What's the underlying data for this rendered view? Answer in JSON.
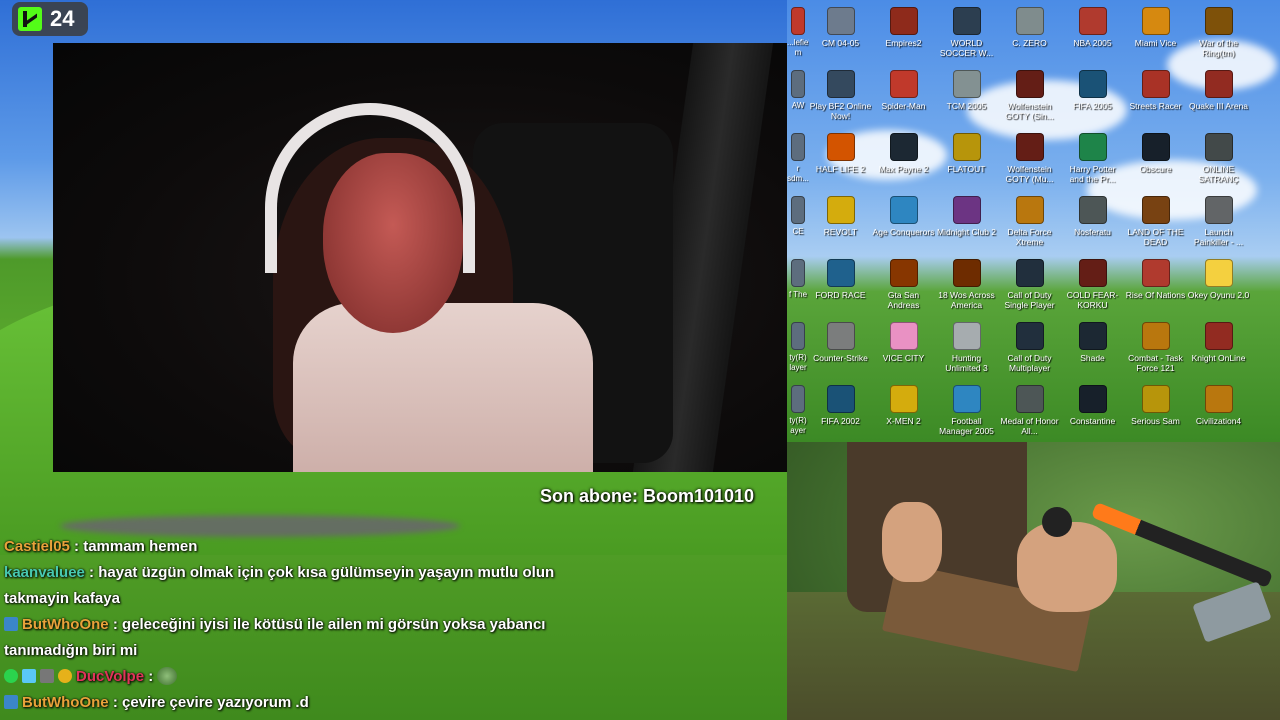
{
  "kick": {
    "viewer_count": "24"
  },
  "overlay": {
    "last_subscriber": "Son abone: Boom101010"
  },
  "chat": [
    {
      "user": "Castiel05",
      "user_color": "#e8a23a",
      "text": " : tammam hemen",
      "badges": []
    },
    {
      "user": "kaanvaluee",
      "user_color": "#48c9b0",
      "text": " : hayat üzgün olmak için çok kısa gülümseyin yaşayın mutlu olun takmayin kafaya",
      "badges": []
    },
    {
      "user": "ButWhoOne",
      "user_color": "#e8a23a",
      "text": " : geleceğini iyisi ile kötüsü ile ailen mi görsün yoksa yabancı tanımadığın biri mi",
      "badges": [
        "blue"
      ]
    },
    {
      "user": "DucVolpe",
      "user_color": "#e0345a",
      "text": " : ",
      "badges": [
        "green",
        "cube",
        "gray",
        "gold"
      ],
      "emote": "frog-emote"
    },
    {
      "user": "ButWhoOne",
      "user_color": "#e8a23a",
      "text": " : çevire çevire yazıyorum .d",
      "badges": [
        "blue"
      ]
    }
  ],
  "desktop": {
    "rows": [
      [
        {
          "label": "...lefield m",
          "color": "#c0392b"
        },
        {
          "label": "CM 04-05",
          "color": "#6d7b8d"
        },
        {
          "label": "Empires2",
          "color": "#8e2a1b"
        },
        {
          "label": "WORLD SOCCER W...",
          "color": "#2c3e50"
        },
        {
          "label": "C. ZERO",
          "color": "#7f8c8d"
        },
        {
          "label": "NBA 2005",
          "color": "#b03a2e"
        },
        {
          "label": "Miami Vice",
          "color": "#d68910"
        },
        {
          "label": "War of the Ring(tm)",
          "color": "#7e5109"
        }
      ],
      [
        {
          "label": "AW",
          "color": "#5d6d7e"
        },
        {
          "label": "Play BF2 Online Now!",
          "color": "#34495e"
        },
        {
          "label": "Spider-Man",
          "color": "#c0392b"
        },
        {
          "label": "TCM 2005",
          "color": "#839192"
        },
        {
          "label": "Wolfenstein GOTY (Sin...",
          "color": "#641e16"
        },
        {
          "label": "FIFA 2005",
          "color": "#1a5276"
        },
        {
          "label": "Streets Racer",
          "color": "#a93226"
        },
        {
          "label": "Quake III Arena",
          "color": "#922b21"
        }
      ],
      [
        {
          "label": "r sdm...",
          "color": "#5d6d7e"
        },
        {
          "label": "HALF LIFE 2",
          "color": "#d35400"
        },
        {
          "label": "Max Payne 2",
          "color": "#1c2833"
        },
        {
          "label": "FLATOUT",
          "color": "#b7950b"
        },
        {
          "label": "Wolfenstein GOTY (Mu...",
          "color": "#641e16"
        },
        {
          "label": "Harry Potter and the Pr...",
          "color": "#1e8449"
        },
        {
          "label": "Obscure",
          "color": "#17202a"
        },
        {
          "label": "ONLINE SATRANÇ",
          "color": "#424949"
        }
      ],
      [
        {
          "label": "CE",
          "color": "#5d6d7e"
        },
        {
          "label": "REVOLT",
          "color": "#d4ac0d"
        },
        {
          "label": "Age Conquerors",
          "color": "#2e86c1"
        },
        {
          "label": "Midnight Club 2",
          "color": "#6c3483"
        },
        {
          "label": "Delta Force Xtreme",
          "color": "#b9770e"
        },
        {
          "label": "Nosferatu",
          "color": "#4d5656"
        },
        {
          "label": "LAND OF THE DEAD",
          "color": "#784212"
        },
        {
          "label": "Launch Painkiller - ...",
          "color": "#626567"
        }
      ],
      [
        {
          "label": "f The",
          "color": "#5d6d7e"
        },
        {
          "label": "FORD RACE",
          "color": "#1f618d"
        },
        {
          "label": "Gta San Andreas",
          "color": "#873600"
        },
        {
          "label": "18 Wos Across America",
          "color": "#6e2c00"
        },
        {
          "label": "Call of Duty Single Player",
          "color": "#212f3d"
        },
        {
          "label": "COLD FEAR-KORKU",
          "color": "#641e16"
        },
        {
          "label": "Rise Of Nations",
          "color": "#b03a2e"
        },
        {
          "label": "Okey Oyunu 2.0",
          "color": "#f4d03f"
        }
      ],
      [
        {
          "label": "ty(R) layer",
          "color": "#5d6d7e"
        },
        {
          "label": "Counter-Strike",
          "color": "#7b7d7d"
        },
        {
          "label": "VICE CITY",
          "color": "#e991c3"
        },
        {
          "label": "Hunting Unlimited 3",
          "color": "#a6acaf"
        },
        {
          "label": "Call of Duty Multiplayer",
          "color": "#212f3d"
        },
        {
          "label": "Shade",
          "color": "#1c2833"
        },
        {
          "label": "Combat - Task Force 121",
          "color": "#b9770e"
        },
        {
          "label": "Knight OnLine",
          "color": "#922b21"
        }
      ],
      [
        {
          "label": "ty(R) ayer",
          "color": "#5d6d7e"
        },
        {
          "label": "FIFA 2002",
          "color": "#1a5276"
        },
        {
          "label": "X-MEN 2",
          "color": "#d4ac0d"
        },
        {
          "label": "Football Manager 2005",
          "color": "#2e86c1"
        },
        {
          "label": "Medal of Honor All...",
          "color": "#4d5656"
        },
        {
          "label": "Constantine",
          "color": "#17202a"
        },
        {
          "label": "Serious Sam",
          "color": "#b7950b"
        },
        {
          "label": "Civilization4",
          "color": "#b9770e"
        }
      ]
    ]
  }
}
